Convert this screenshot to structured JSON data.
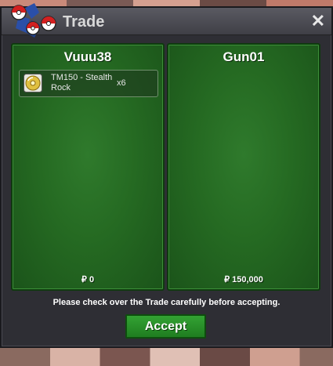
{
  "window": {
    "title": "Trade",
    "close_symbol": "✕"
  },
  "traders": [
    {
      "name": "Vuuu38",
      "money": "₽ 0",
      "items": [
        {
          "name": "TM150 - Stealth Rock",
          "quantity": "x6",
          "icon": "disc-icon"
        }
      ]
    },
    {
      "name": "Gun01",
      "money": "₽ 150,000",
      "items": []
    }
  ],
  "footer": {
    "notice": "Please check over the Trade carefully before accepting.",
    "accept_label": "Accept"
  },
  "colors": {
    "panel_green": "#256a22",
    "accept_green": "#2a9a2a",
    "window_dark": "#2e2e34"
  }
}
